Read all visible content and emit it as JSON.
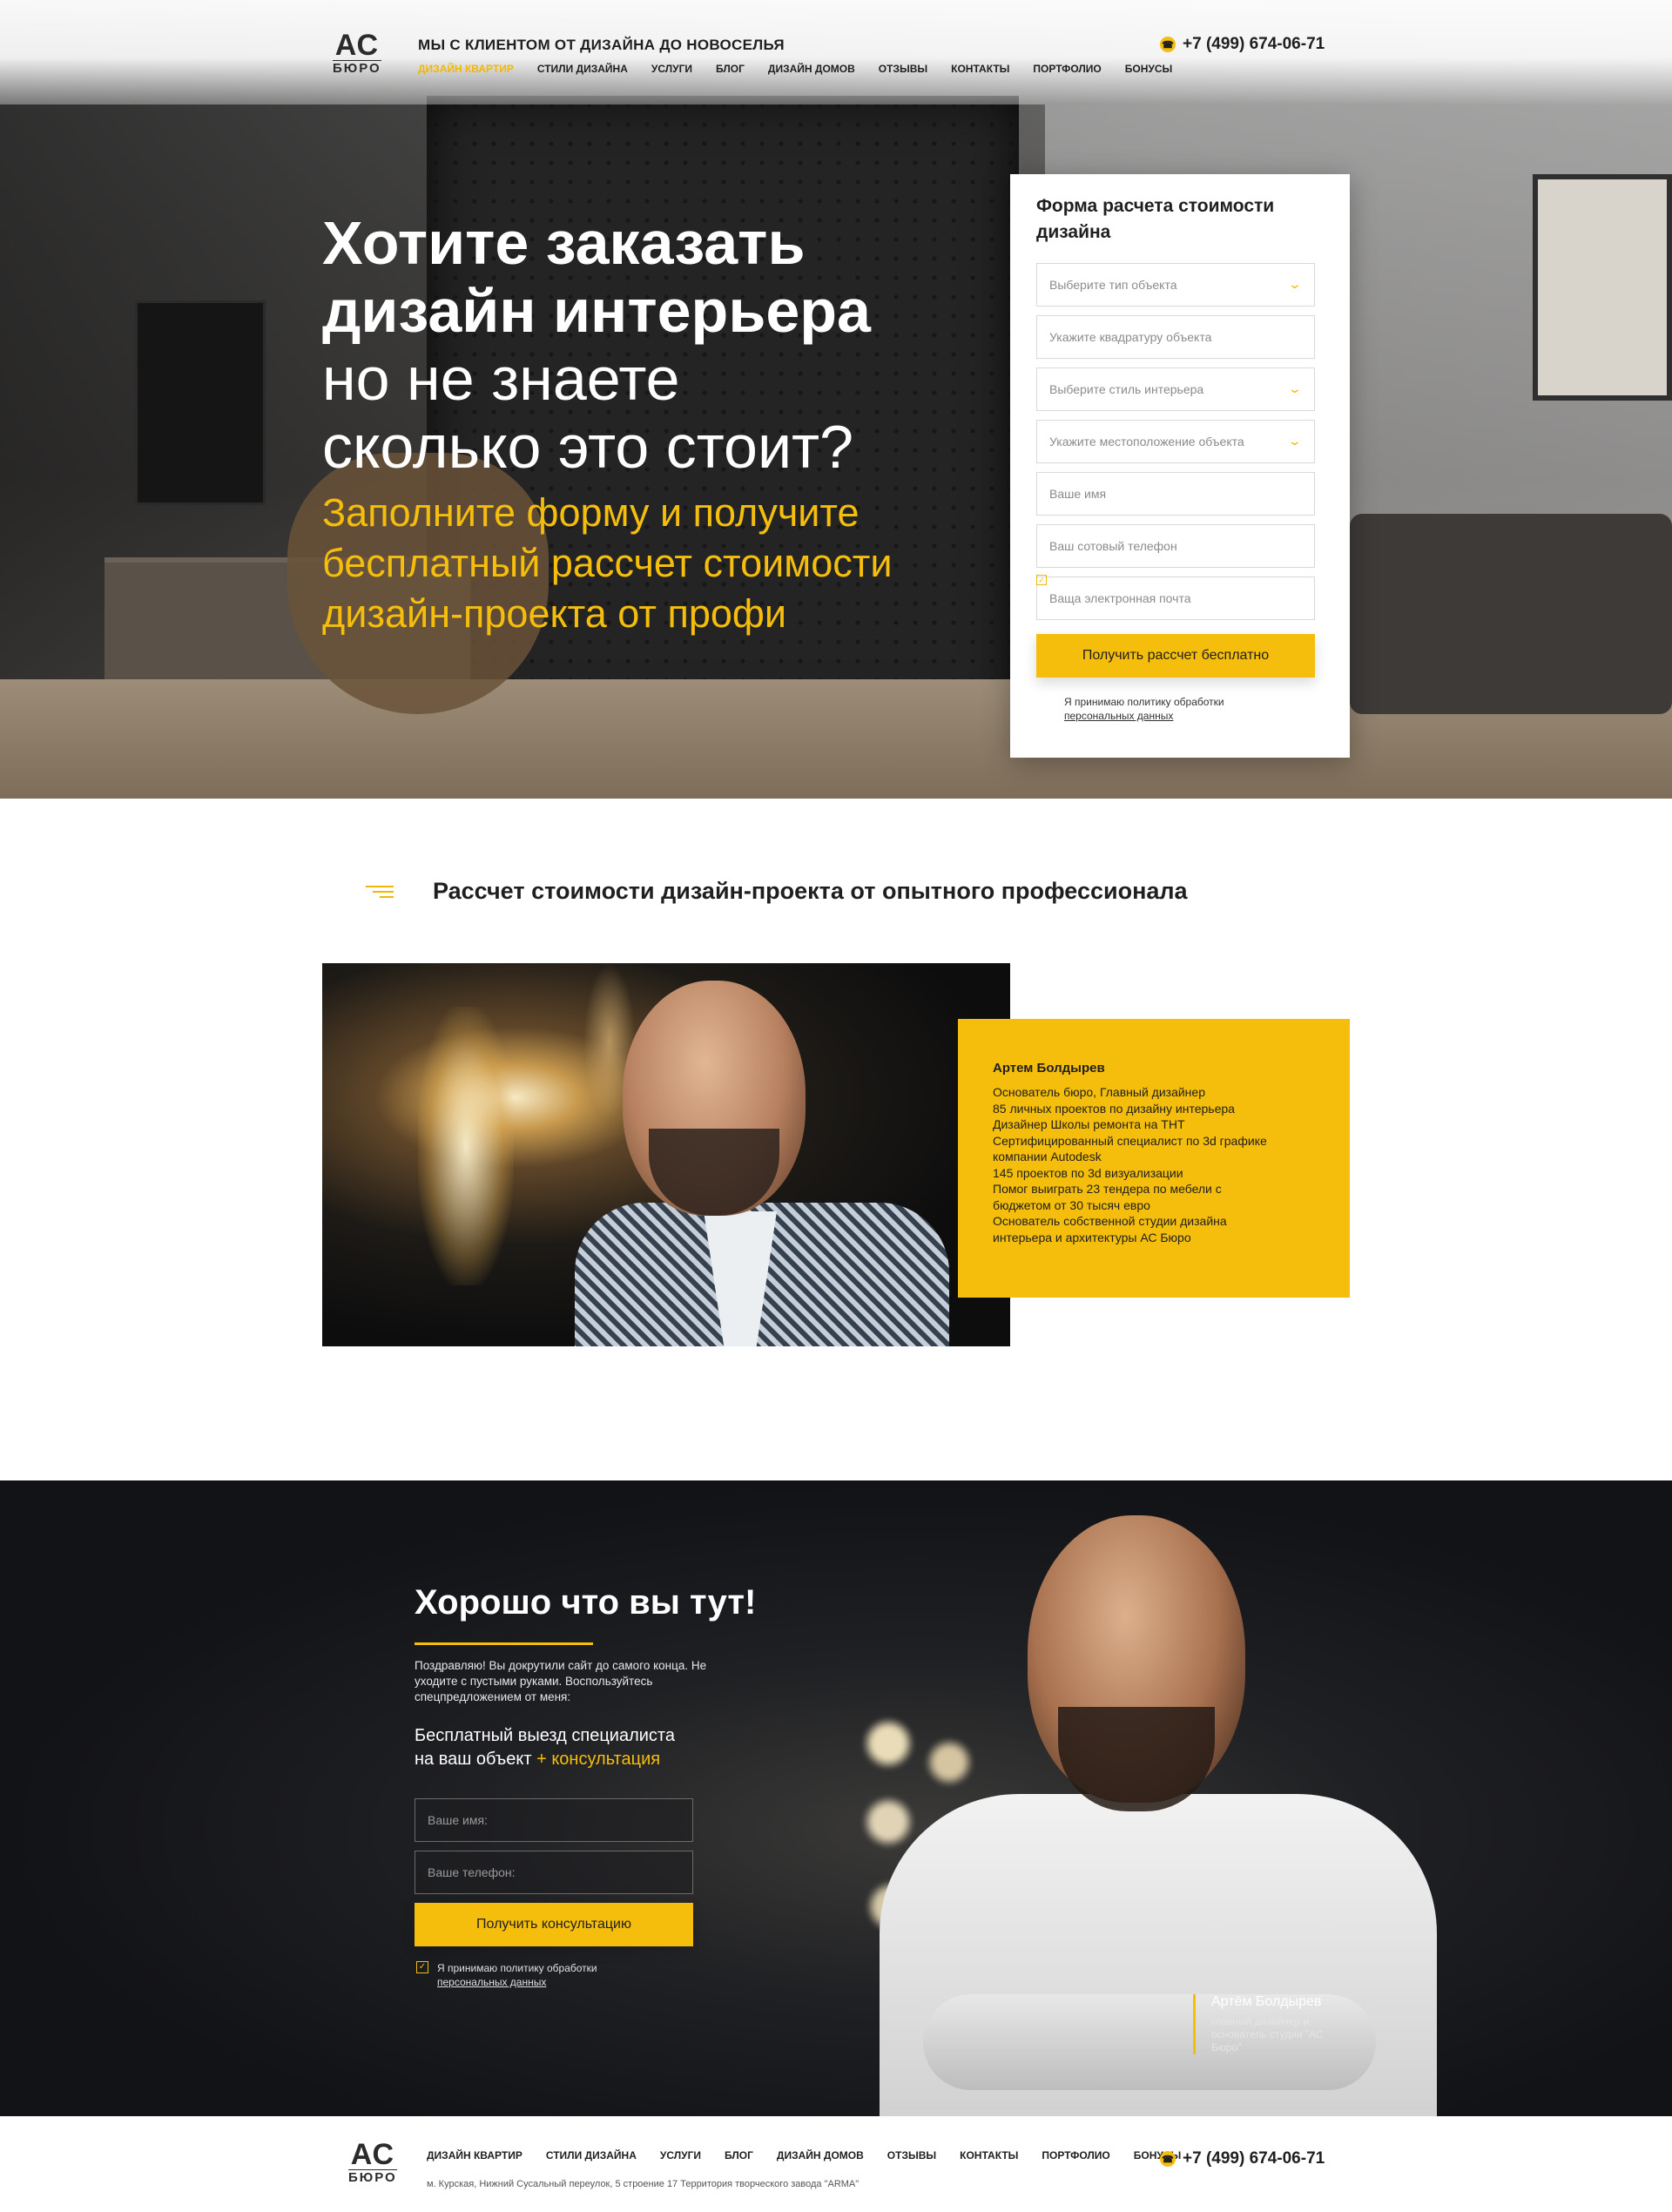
{
  "brand": {
    "logo_top": "АС",
    "logo_bottom": "БЮРО"
  },
  "header": {
    "tagline": "МЫ С КЛИЕНТОМ ОТ ДИЗАЙНА ДО НОВОСЕЛЬЯ",
    "phone": "+7 (499) 674-06-71",
    "nav": [
      "ДИЗАЙН КВАРТИР",
      "СТИЛИ ДИЗАЙНА",
      "УСЛУГИ",
      "БЛОГ",
      "ДИЗАЙН ДОМОВ",
      "ОТЗЫВЫ",
      "КОНТАКТЫ",
      "ПОРТФОЛИО",
      "БОНУСЫ"
    ],
    "active_nav": "ДИЗАЙН КВАРТИР"
  },
  "hero": {
    "line1": "Хотите заказать",
    "line2": "дизайн интерьера",
    "line3": "но не знаете",
    "line4": "сколько это стоит?",
    "sub1": "Заполните форму и получите",
    "sub2": "бесплатный рассчет стоимости",
    "sub3": "дизайн-проекта от профи"
  },
  "calc_form": {
    "title": "Форма расчета стоимости дизайна",
    "fields": [
      "Выберите тип объекта",
      "Укажите квадратуру объекта",
      "Выберите стиль интерьера",
      "Укажите местоположение объекта",
      "Ваше имя",
      "Ваш сотовый телефон",
      "Ваща электронная почта"
    ],
    "submit": "Получить рассчет бесплатно",
    "consent_line1": "Я принимаю политику обработки",
    "consent_line2": "персональных данных"
  },
  "expert_section": {
    "title": "Рассчет стоимости дизайн-проекта от опытного профессионала",
    "name": "Артем Болдырев",
    "facts": [
      "Основатель бюро,  Главный дизайнер",
      "85 личных проектов по дизайну интерьера",
      "Дизайнер Школы ремонта на ТНТ",
      "Сертифицированный специалист по 3d графике",
      "компании Autodesk",
      "145 проектов по 3d визуализации",
      "Помог выиграть 23 тендера по мебели с",
      "бюджетом от 30 тысяч евро",
      "Основатель собственной студии дизайна",
      "интерьера и архитектуры АС Бюро"
    ]
  },
  "final_section": {
    "title": "Хорошо что вы тут!",
    "intro": "Поздравляю! Вы докрутили сайт до самого конца. Не уходите с пустыми руками. Воспользуйтесь спецпредложением от меня:",
    "offer_line1": "Бесплатный выезд специалиста",
    "offer_line2": "на ваш объект",
    "offer_highlight": "+ консультация",
    "name_placeholder": "Ваше имя:",
    "phone_placeholder": "Ваше телефон:",
    "submit": "Получить консультацию",
    "consent_line1": "Я принимаю политику обработки",
    "consent_line2": "персональных данных",
    "signature_name": "Артём Болдырев",
    "signature_role": "главный дизайнер и основатель студии \"АС Бюро\""
  },
  "footer": {
    "nav": [
      "ДИЗАЙН КВАРТИР",
      "СТИЛИ ДИЗАЙНА",
      "УСЛУГИ",
      "БЛОГ",
      "ДИЗАЙН ДОМОВ",
      "ОТЗЫВЫ",
      "КОНТАКТЫ",
      "ПОРТФОЛИО",
      "БОНУСЫ"
    ],
    "address": "м. Курская, Нижний Сусальный переулок, 5 строение 17   Территория творческого завода \"ARMA\"",
    "phone": "+7 (499) 674-06-71"
  },
  "colors": {
    "accent": "#f5bd0c",
    "dark": "#1f1f1f"
  },
  "icons": [
    "phone-icon",
    "chevron-down-icon",
    "lines-icon",
    "checkbox-check-icon"
  ]
}
